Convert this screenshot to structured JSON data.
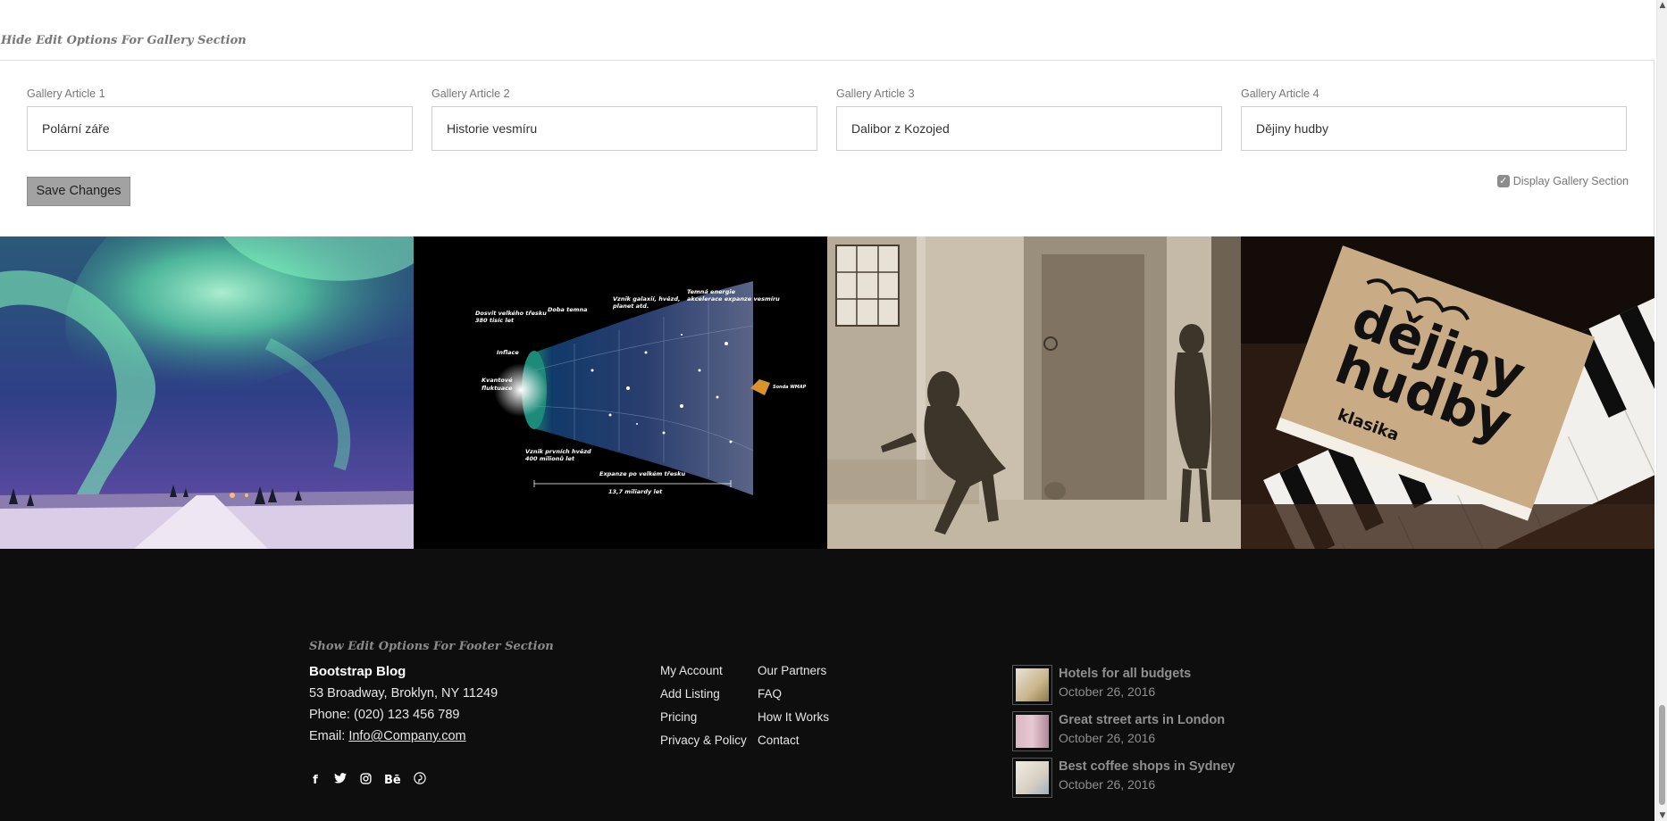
{
  "gallery_editor": {
    "toggle_label": "Hide Edit Options For Gallery Section",
    "fields": [
      {
        "label": "Gallery Article 1",
        "value": "Polární záře"
      },
      {
        "label": "Gallery Article 2",
        "value": "Historie vesmíru"
      },
      {
        "label": "Gallery Article 3",
        "value": "Dalibor z Kozojed"
      },
      {
        "label": "Gallery Article 4",
        "value": "Dějiny hudby"
      }
    ],
    "save_label": "Save Changes",
    "display_label": "Display Gallery Section",
    "display_checked": true
  },
  "gallery": {
    "universe_labels": {
      "t1": "Dosvit velkého třesku",
      "t1b": "380 tisíc let",
      "t2": "Doba temna",
      "t3": "Vznik galaxií, hvězd,",
      "t3b": "planet atd.",
      "t4": "Temná energie",
      "t4b": "akcelerace expanze vesmíru",
      "t5": "Inflace",
      "t6": "Kvantové",
      "t6b": "fluktuace",
      "t7": "Vznik prvních hvězd",
      "t7b": "400 milionů let",
      "t8": "Expanze po velkém třesku",
      "t9": "13,7 miliardy let",
      "t10": "Sonda WMAP"
    },
    "book_title_1": "dějiny",
    "book_title_2": "hudby",
    "book_sub": "klasika"
  },
  "footer": {
    "toggle_label": "Show Edit Options For Footer Section",
    "brand": "Bootstrap Blog",
    "address": "53 Broadway, Broklyn, NY 11249",
    "phone": "Phone: (020) 123 456 789",
    "email_prefix": "Email: ",
    "email": "Info@Company.com",
    "links_col1": [
      "My Account",
      "Add Listing",
      "Pricing",
      "Privacy & Policy"
    ],
    "links_col2": [
      "Our Partners",
      "FAQ",
      "How It Works",
      "Contact"
    ],
    "posts": [
      {
        "title": "Hotels for all budgets",
        "date": "October 26, 2016"
      },
      {
        "title": "Great street arts in London",
        "date": "October 26, 2016"
      },
      {
        "title": "Best coffee shops in Sydney",
        "date": "October 26, 2016"
      }
    ],
    "socials": [
      "facebook-icon",
      "twitter-icon",
      "instagram-icon",
      "behance-icon",
      "pinterest-icon"
    ]
  }
}
